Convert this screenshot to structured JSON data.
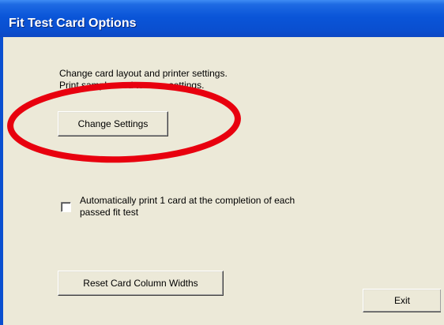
{
  "window": {
    "title": "Fit Test Card Options"
  },
  "description": {
    "line1": "Change card layout and printer settings.",
    "line2": "Print sample card to save settings."
  },
  "buttons": {
    "change_settings": "Change Settings",
    "reset_widths": "Reset Card Column Widths",
    "exit": "Exit"
  },
  "auto_print": {
    "checked": false,
    "label_line1": "Automatically print 1 card at the completion of each",
    "label_line2": "passed fit test"
  },
  "colors": {
    "titlebar": "#0a55d8",
    "dialog_bg": "#ece9d8",
    "annotation": "#e8000e"
  }
}
